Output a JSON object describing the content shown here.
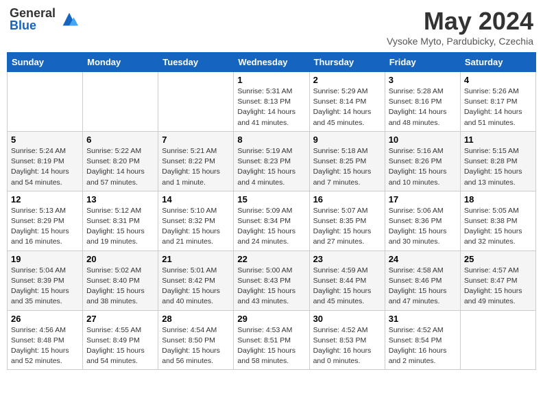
{
  "header": {
    "logo_general": "General",
    "logo_blue": "Blue",
    "month_title": "May 2024",
    "location": "Vysoke Myto, Pardubicky, Czechia"
  },
  "days_of_week": [
    "Sunday",
    "Monday",
    "Tuesday",
    "Wednesday",
    "Thursday",
    "Friday",
    "Saturday"
  ],
  "weeks": [
    [
      {
        "day": "",
        "info": ""
      },
      {
        "day": "",
        "info": ""
      },
      {
        "day": "",
        "info": ""
      },
      {
        "day": "1",
        "info": "Sunrise: 5:31 AM\nSunset: 8:13 PM\nDaylight: 14 hours\nand 41 minutes."
      },
      {
        "day": "2",
        "info": "Sunrise: 5:29 AM\nSunset: 8:14 PM\nDaylight: 14 hours\nand 45 minutes."
      },
      {
        "day": "3",
        "info": "Sunrise: 5:28 AM\nSunset: 8:16 PM\nDaylight: 14 hours\nand 48 minutes."
      },
      {
        "day": "4",
        "info": "Sunrise: 5:26 AM\nSunset: 8:17 PM\nDaylight: 14 hours\nand 51 minutes."
      }
    ],
    [
      {
        "day": "5",
        "info": "Sunrise: 5:24 AM\nSunset: 8:19 PM\nDaylight: 14 hours\nand 54 minutes."
      },
      {
        "day": "6",
        "info": "Sunrise: 5:22 AM\nSunset: 8:20 PM\nDaylight: 14 hours\nand 57 minutes."
      },
      {
        "day": "7",
        "info": "Sunrise: 5:21 AM\nSunset: 8:22 PM\nDaylight: 15 hours\nand 1 minute."
      },
      {
        "day": "8",
        "info": "Sunrise: 5:19 AM\nSunset: 8:23 PM\nDaylight: 15 hours\nand 4 minutes."
      },
      {
        "day": "9",
        "info": "Sunrise: 5:18 AM\nSunset: 8:25 PM\nDaylight: 15 hours\nand 7 minutes."
      },
      {
        "day": "10",
        "info": "Sunrise: 5:16 AM\nSunset: 8:26 PM\nDaylight: 15 hours\nand 10 minutes."
      },
      {
        "day": "11",
        "info": "Sunrise: 5:15 AM\nSunset: 8:28 PM\nDaylight: 15 hours\nand 13 minutes."
      }
    ],
    [
      {
        "day": "12",
        "info": "Sunrise: 5:13 AM\nSunset: 8:29 PM\nDaylight: 15 hours\nand 16 minutes."
      },
      {
        "day": "13",
        "info": "Sunrise: 5:12 AM\nSunset: 8:31 PM\nDaylight: 15 hours\nand 19 minutes."
      },
      {
        "day": "14",
        "info": "Sunrise: 5:10 AM\nSunset: 8:32 PM\nDaylight: 15 hours\nand 21 minutes."
      },
      {
        "day": "15",
        "info": "Sunrise: 5:09 AM\nSunset: 8:34 PM\nDaylight: 15 hours\nand 24 minutes."
      },
      {
        "day": "16",
        "info": "Sunrise: 5:07 AM\nSunset: 8:35 PM\nDaylight: 15 hours\nand 27 minutes."
      },
      {
        "day": "17",
        "info": "Sunrise: 5:06 AM\nSunset: 8:36 PM\nDaylight: 15 hours\nand 30 minutes."
      },
      {
        "day": "18",
        "info": "Sunrise: 5:05 AM\nSunset: 8:38 PM\nDaylight: 15 hours\nand 32 minutes."
      }
    ],
    [
      {
        "day": "19",
        "info": "Sunrise: 5:04 AM\nSunset: 8:39 PM\nDaylight: 15 hours\nand 35 minutes."
      },
      {
        "day": "20",
        "info": "Sunrise: 5:02 AM\nSunset: 8:40 PM\nDaylight: 15 hours\nand 38 minutes."
      },
      {
        "day": "21",
        "info": "Sunrise: 5:01 AM\nSunset: 8:42 PM\nDaylight: 15 hours\nand 40 minutes."
      },
      {
        "day": "22",
        "info": "Sunrise: 5:00 AM\nSunset: 8:43 PM\nDaylight: 15 hours\nand 43 minutes."
      },
      {
        "day": "23",
        "info": "Sunrise: 4:59 AM\nSunset: 8:44 PM\nDaylight: 15 hours\nand 45 minutes."
      },
      {
        "day": "24",
        "info": "Sunrise: 4:58 AM\nSunset: 8:46 PM\nDaylight: 15 hours\nand 47 minutes."
      },
      {
        "day": "25",
        "info": "Sunrise: 4:57 AM\nSunset: 8:47 PM\nDaylight: 15 hours\nand 49 minutes."
      }
    ],
    [
      {
        "day": "26",
        "info": "Sunrise: 4:56 AM\nSunset: 8:48 PM\nDaylight: 15 hours\nand 52 minutes."
      },
      {
        "day": "27",
        "info": "Sunrise: 4:55 AM\nSunset: 8:49 PM\nDaylight: 15 hours\nand 54 minutes."
      },
      {
        "day": "28",
        "info": "Sunrise: 4:54 AM\nSunset: 8:50 PM\nDaylight: 15 hours\nand 56 minutes."
      },
      {
        "day": "29",
        "info": "Sunrise: 4:53 AM\nSunset: 8:51 PM\nDaylight: 15 hours\nand 58 minutes."
      },
      {
        "day": "30",
        "info": "Sunrise: 4:52 AM\nSunset: 8:53 PM\nDaylight: 16 hours\nand 0 minutes."
      },
      {
        "day": "31",
        "info": "Sunrise: 4:52 AM\nSunset: 8:54 PM\nDaylight: 16 hours\nand 2 minutes."
      },
      {
        "day": "",
        "info": ""
      }
    ]
  ]
}
